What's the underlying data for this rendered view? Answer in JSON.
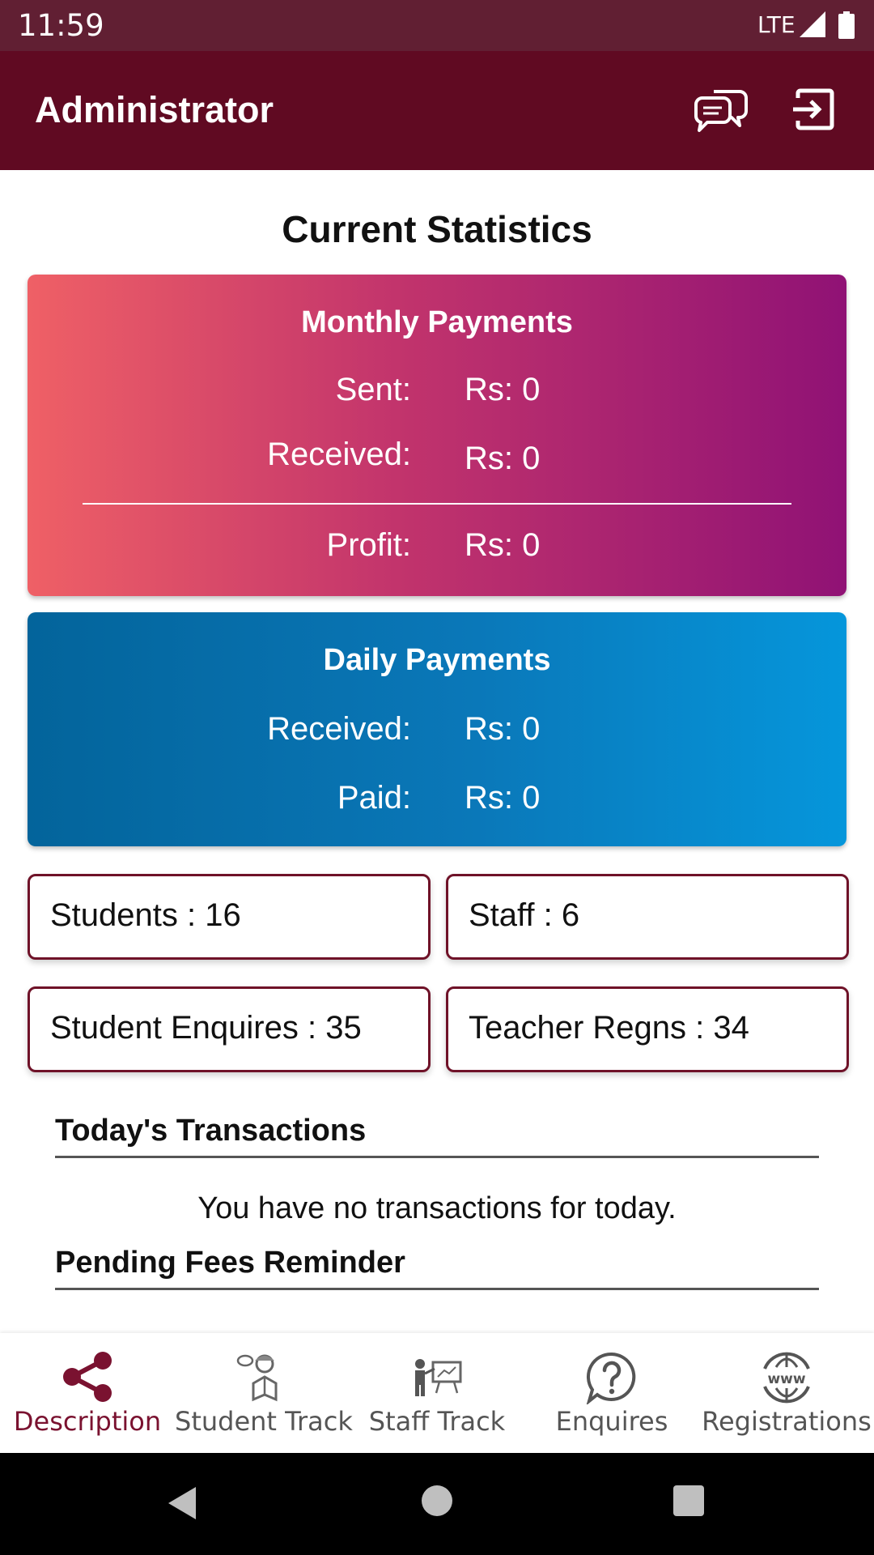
{
  "status_bar": {
    "time": "11:59",
    "network": "LTE"
  },
  "app_bar": {
    "title": "Administrator",
    "icons": [
      "chat-icon",
      "exit-icon"
    ]
  },
  "page": {
    "heading": "Current Statistics"
  },
  "monthly_payments": {
    "title": "Monthly Payments",
    "sent_label": "Sent:",
    "sent_value": "Rs: 0",
    "received_label": "Received:",
    "received_value": "Rs: 0",
    "profit_label": "Profit:",
    "profit_value": "Rs: 0",
    "colors": {
      "start": "#ef6066",
      "end": "#901275"
    }
  },
  "daily_payments": {
    "title": "Daily Payments",
    "received_label": "Received:",
    "received_value": "Rs: 0",
    "paid_label": "Paid:",
    "paid_value": "Rs: 0",
    "colors": {
      "start": "#03649b",
      "end": "#0596db"
    }
  },
  "stats": {
    "students": "Students : 16",
    "staff": "Staff : 6",
    "student_enquires": "Student Enquires : 35",
    "teacher_regns": "Teacher Regns : 34"
  },
  "transactions": {
    "title": "Today's Transactions",
    "empty_message": "You have no transactions for today."
  },
  "pending_fees": {
    "title": "Pending Fees Reminder"
  },
  "bottom_nav": {
    "items": [
      {
        "label": "Description",
        "icon": "share-icon",
        "active": true
      },
      {
        "label": "Student Track",
        "icon": "student-reading-icon",
        "active": false
      },
      {
        "label": "Staff Track",
        "icon": "teacher-board-icon",
        "active": false
      },
      {
        "label": "Enquires",
        "icon": "question-bubble-icon",
        "active": false
      },
      {
        "label": "Registrations",
        "icon": "www-globe-icon",
        "active": false
      }
    ]
  },
  "theme": {
    "primary": "#600a22",
    "status_bar": "#611f33",
    "accent": "#7a1230"
  }
}
